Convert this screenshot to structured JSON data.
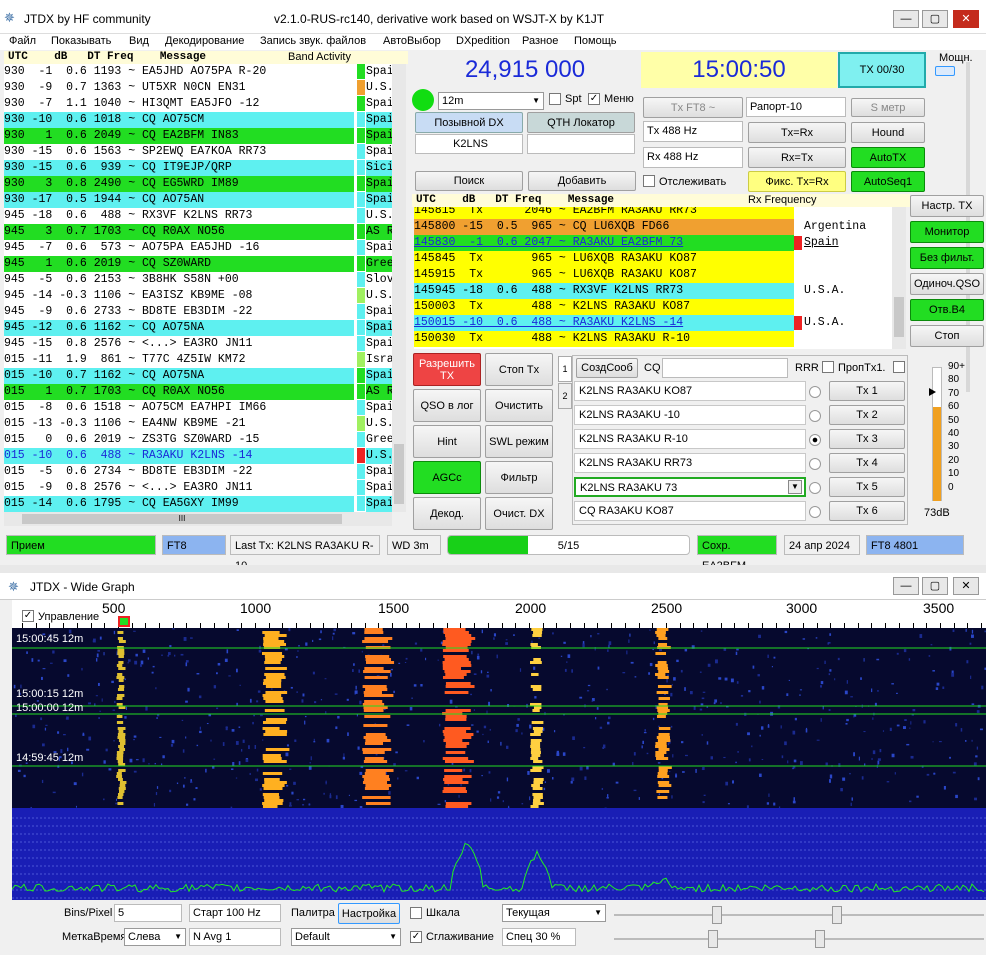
{
  "window": {
    "title": "JTDX  by HF community",
    "version": "v2.1.0-RUS-rc140, derivative work based on WSJT-X by K1JT",
    "btn_min": "—",
    "btn_max": "▢",
    "btn_close": "✕"
  },
  "menu": [
    "Файл",
    "Показывать",
    "Вид",
    "Декодирование",
    "Запись звук. файлов",
    "АвтоВыбор",
    "DXpedition",
    "Разное",
    "Помощь"
  ],
  "band_activity": {
    "header": "UTC    dB   DT Freq    Message",
    "title": "Band Activity",
    "rows": [
      {
        "t": "930  -1  0.6 1193 ~ EA5JHD AO75PA R-20",
        "c": "Spai",
        "bg": "#ffffff",
        "mark": "#22dd22"
      },
      {
        "t": "930  -9  0.7 1363 ~ UT5XR N0CN EN31",
        "c": "U.S.",
        "bg": "#ffffff",
        "mark": "#f0a030"
      },
      {
        "t": "930  -7  1.1 1040 ~ HI3QMT EA5JFO -12",
        "c": "Spai",
        "bg": "#ffffff",
        "mark": "#22dd22"
      },
      {
        "t": "930 -10  0.6 1018 ~ CQ AO75CM",
        "c": "Spai",
        "bg": "#5ef0f0",
        "mark": "#5ef0f0"
      },
      {
        "t": "930   1  0.6 2049 ~ CQ EA2BFM IN83",
        "c": "Spai",
        "bg": "#22dd22",
        "mark": "#22dd22"
      },
      {
        "t": "930 -15  0.6 1563 ~ SP2EWQ EA7KOA RR73",
        "c": "Spai",
        "bg": "#ffffff",
        "mark": "#5ef0f0"
      },
      {
        "t": "930 -15  0.6  939 ~ CQ IT9EJP/QRP",
        "c": "Sici",
        "bg": "#5ef0f0",
        "mark": "#5ef0f0"
      },
      {
        "t": "930   3  0.8 2490 ~ CQ EG5WRD IM89",
        "c": "Spai",
        "bg": "#22dd22",
        "mark": "#22dd22"
      },
      {
        "t": "930 -17  0.5 1944 ~ CQ AO75AN",
        "c": "Spai",
        "bg": "#5ef0f0",
        "mark": "#5ef0f0"
      },
      {
        "t": "945 -18  0.6  488 ~ RX3VF K2LNS RR73",
        "c": "U.S.",
        "bg": "#ffffff",
        "mark": "#5ef0f0"
      },
      {
        "t": "945   3  0.7 1703 ~ CQ R0AX NO56",
        "c": "AS R",
        "bg": "#22dd22",
        "mark": "#22dd22"
      },
      {
        "t": "945  -7  0.6  573 ~ AO75PA EA5JHD -16",
        "c": "Spai",
        "bg": "#ffffff",
        "mark": "#5ef0f0"
      },
      {
        "t": "945   1  0.6 2019 ~ CQ SZ0WARD",
        "c": "Gree",
        "bg": "#22dd22",
        "mark": "#22dd22"
      },
      {
        "t": "945  -5  0.6 2153 ~ 3B8HK S58N +00",
        "c": "Slov",
        "bg": "#ffffff",
        "mark": "#5ef0f0"
      },
      {
        "t": "945 -14 -0.3 1106 ~ EA3ISZ KB9ME -08",
        "c": "U.S.",
        "bg": "#ffffff",
        "mark": "#a0f060"
      },
      {
        "t": "945  -9  0.6 2733 ~ BD8TE EB3DIM -22",
        "c": "Spai",
        "bg": "#ffffff",
        "mark": "#5ef0f0"
      },
      {
        "t": "945 -12  0.6 1162 ~ CQ AO75NA",
        "c": "Spai",
        "bg": "#5ef0f0",
        "mark": "#5ef0f0"
      },
      {
        "t": "945 -15  0.8 2576 ~ <...> EA3RO JN11",
        "c": "Spai",
        "bg": "#ffffff",
        "mark": "#5ef0f0"
      },
      {
        "t": "015 -11  1.9  861 ~ T77C 4Z5IW KM72",
        "c": "Isra",
        "bg": "#ffffff",
        "mark": "#a0f060"
      },
      {
        "t": "015 -10  0.7 1162 ~ CQ AO75NA",
        "c": "Spai",
        "bg": "#5ef0f0",
        "mark": "#22dd22"
      },
      {
        "t": "015   1  0.7 1703 ~ CQ R0AX NO56",
        "c": "AS R",
        "bg": "#22dd22",
        "mark": "#22dd22"
      },
      {
        "t": "015  -8  0.6 1518 ~ AO75CM EA7HPI IM66",
        "c": "Spai",
        "bg": "#ffffff",
        "mark": "#5ef0f0"
      },
      {
        "t": "015 -13 -0.3 1106 ~ EA4NW KB9ME -21",
        "c": "U.S.",
        "bg": "#ffffff",
        "mark": "#a0f060"
      },
      {
        "t": "015   0  0.6 2019 ~ ZS3TG SZ0WARD -15",
        "c": "Gree",
        "bg": "#ffffff",
        "mark": "#5ef0f0"
      },
      {
        "t": "015 -10  0.6  488 ~ RA3AKU K2LNS -14",
        "c": "U.S.",
        "bg": "#5ef0f0",
        "mark": "#ee2222",
        "fg": "#1a2ad8"
      },
      {
        "t": "015  -5  0.6 2734 ~ BD8TE EB3DIM -22",
        "c": "Spai",
        "bg": "#ffffff",
        "mark": "#5ef0f0"
      },
      {
        "t": "015  -9  0.8 2576 ~ <...> EA3RO JN11",
        "c": "Spai",
        "bg": "#ffffff",
        "mark": "#5ef0f0"
      },
      {
        "t": "015 -14  0.6 1795 ~ CQ EA5GXY IM99",
        "c": "Spai",
        "bg": "#5ef0f0",
        "mark": "#5ef0f0"
      }
    ]
  },
  "freq_display": "24,915 000",
  "time_display": "15:00:50",
  "tx_counter": "TX 00/30",
  "power_label": "Мощн.",
  "band_select": "12m",
  "spt_label": "Spt",
  "menu_label": "Меню",
  "dx_call_label": "Позывной DX",
  "dx_grid_label": "QTH Локатор",
  "dx_call_value": "K2LNS",
  "search_btn": "Поиск",
  "add_btn": "Добавить",
  "tx_ft8": "Tx FT8 ~",
  "report_label": "Рапорт",
  "report_value": "-10",
  "smeter_btn": "S метр",
  "tx_hz": "Tx  488  Hz",
  "rx_hz": "Rx  488  Hz",
  "tx_eq_rx": "Tx=Rx",
  "rx_eq_tx": "Rx=Tx",
  "hound": "Hound",
  "autotx": "AutoTX",
  "follow_label": "Отслеживать",
  "fix_tx_rx": "Фикс. Tx=Rx",
  "autoseq": "AutoSeq1",
  "rx_panel": {
    "header": "UTC    dB   DT Freq    Message",
    "title": "Rx Frequency",
    "rows": [
      {
        "t": "145815  Tx      2046 ~ EA2BFM RA3AKU RR73",
        "bg": "#ffff00",
        "fg": "#000",
        "c": ""
      },
      {
        "t": "145800 -15  0.5  965 ~ CQ LU6XQB FD66",
        "bg": "#f0a030",
        "fg": "#000",
        "c": "Argentina"
      },
      {
        "t": "145830  -1  0.6 2047 ~ RA3AKU EA2BFM 73",
        "bg": "#22dd22",
        "fg": "#1a2ad8",
        "c": "Spain",
        "mark": "#ee2222"
      },
      {
        "t": "145845  Tx       965 ~ LU6XQB RA3AKU KO87",
        "bg": "#ffff00",
        "fg": "#000",
        "c": ""
      },
      {
        "t": "145915  Tx       965 ~ LU6XQB RA3AKU KO87",
        "bg": "#ffff00",
        "fg": "#000",
        "c": ""
      },
      {
        "t": "145945 -18  0.6  488 ~ RX3VF K2LNS RR73",
        "bg": "#5ef0f0",
        "fg": "#000",
        "c": "U.S.A."
      },
      {
        "t": "150003  Tx       488 ~ K2LNS RA3AKU KO87",
        "bg": "#ffff00",
        "fg": "#000",
        "c": ""
      },
      {
        "t": "150015 -10  0.6  488 ~ RA3AKU K2LNS -14",
        "bg": "#5ef0f0",
        "fg": "#1a2ad8",
        "c": "U.S.A.",
        "mark": "#ee2222"
      },
      {
        "t": "150030  Tx       488 ~ K2LNS RA3AKU R-10",
        "bg": "#ffff00",
        "fg": "#000",
        "c": ""
      }
    ]
  },
  "right_btns": [
    "Настр. TX",
    "Монитор",
    "Без фильт.",
    "Одиноч.QSO",
    "Отв.В4",
    "Стоп"
  ],
  "ctrl_btns": {
    "enable_tx": "Разрешить TX",
    "stop_tx": "Стоп Tx",
    "qso_log": "QSO в лог",
    "clear": "Очистить",
    "hint": "Hint",
    "swl": "SWL режим",
    "agcc": "AGCc",
    "filter": "Фильтр",
    "decode": "Декод.",
    "clear_dx": "Очист. DX"
  },
  "gen_msgs": "СоздСооб",
  "cq_label": "CQ",
  "rrr_label": "RRR",
  "skip_tx1": "ПропTx1.",
  "tx_msgs": [
    "K2LNS RA3AKU KO87",
    "K2LNS RA3AKU -10",
    "K2LNS RA3AKU R-10",
    "K2LNS RA3AKU RR73",
    "K2LNS RA3AKU 73",
    "CQ RA3AKU KO87"
  ],
  "tx_btns": [
    "Tx 1",
    "Tx 2",
    "Tx 3",
    "Tx 4",
    "Tx 5",
    "Tx 6"
  ],
  "tab_labels": [
    "1",
    "2"
  ],
  "meter": {
    "ticks": [
      "90+",
      "80",
      "70",
      "60",
      "50",
      "40",
      "30",
      "20",
      "10",
      "0"
    ],
    "level_db": "73dB",
    "fill_fraction": 0.7
  },
  "status": {
    "rx": "Прием",
    "mode": "FT8",
    "last_tx": "Last Tx: K2LNS RA3AKU R-10",
    "wd": "WD 3m",
    "progress": "5/15",
    "progress_fraction": 0.33,
    "saved": "Сохр. EA2BFM",
    "date": "24 апр 2024",
    "mode_freq": "FT8  4801"
  },
  "wide_graph": {
    "title": "JTDX - Wide Graph",
    "control_label": "Управление",
    "scale": [
      "500",
      "1000",
      "1500",
      "2000",
      "2500",
      "3000",
      "3500"
    ],
    "time_labels": [
      "15:00:45  12m",
      "15:00:15  12m",
      "15:00:00  12m",
      "14:59:45  12m"
    ],
    "bins_label": "Bins/Pixel",
    "bins_value": "5",
    "start_label": "Старт 100 Hz",
    "palette_label": "Палитра",
    "palette_btn": "Настройка",
    "scale_label": "Шкала",
    "current_label": "Текущая",
    "timestamp_label": "МеткаВремя",
    "timestamp_value": "Слева",
    "navg_label": "N Avg 1",
    "palette_value": "Default",
    "smooth_label": "Сглаживание",
    "spec_label": "Спец 30 %"
  },
  "colors": {
    "green": "#22dd22",
    "cyan": "#5ef0f0",
    "yellow": "#ffff00",
    "orange": "#f0a030",
    "red": "#ee2222",
    "blue_text": "#1a2ad8"
  }
}
